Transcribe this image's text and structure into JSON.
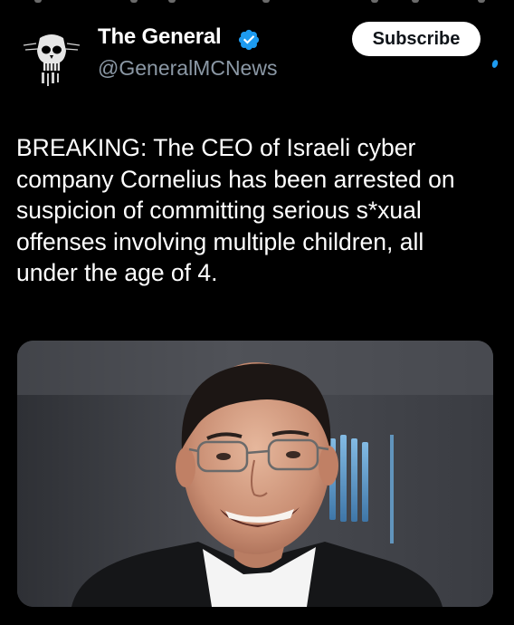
{
  "post": {
    "author": {
      "name": "The General",
      "handle": "@GeneralMCNews",
      "verified_icon": "verified-badge-icon",
      "avatar_icon": "skull-emblem-avatar"
    },
    "subscribe_label": "Subscribe",
    "text": "BREAKING: The CEO of Israeli cyber company Cornelius has been arrested on suspicion of committing serious s*xual offenses involving multiple children, all under the age of 4.",
    "media": {
      "type": "photo",
      "subject": "portrait-photo"
    }
  },
  "colors": {
    "background": "#000000",
    "text_primary": "#ffffff",
    "text_secondary": "#8b98a5",
    "verified_blue": "#1d9bf0",
    "button_bg": "#ffffff",
    "button_text": "#0f1419"
  }
}
